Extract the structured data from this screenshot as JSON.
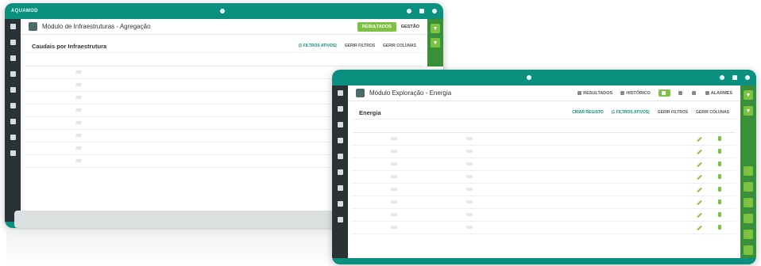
{
  "back_window": {
    "brand": "AQUAMOD",
    "page_title": "Módulo de Infraestruturas - Agregação",
    "actions": {
      "resultados": "RESULTADOS",
      "gestao": "GESTÃO"
    },
    "panel": {
      "title": "Caudais por Infraestrutura",
      "filter_label": "(1 FILTROS ATIVOS)",
      "gerir_filtros": "GERIR FILTROS",
      "gerir_colunas": "GERIR COLUNAS"
    },
    "columns": [
      "",
      "",
      "",
      "",
      "",
      "",
      "",
      ""
    ],
    "rows": [
      {
        "name": "",
        "type": "",
        "infra": "",
        "date": "",
        "value": "",
        "unit": "",
        "pct": "",
        "pct2": ""
      },
      {
        "name": "",
        "type": "",
        "infra": "",
        "date": "",
        "value": "",
        "unit": "",
        "pct": "",
        "pct2": ""
      },
      {
        "name": "",
        "type": "",
        "infra": "",
        "date": "",
        "value": "",
        "unit": "",
        "pct": "",
        "pct2": ""
      },
      {
        "name": "",
        "type": "",
        "infra": "",
        "date": "",
        "value": "",
        "unit": "",
        "pct": "",
        "pct2": ""
      },
      {
        "name": "",
        "type": "",
        "infra": "",
        "date": "",
        "value": "",
        "unit": "",
        "pct": "",
        "pct2": ""
      },
      {
        "name": "",
        "type": "",
        "infra": "",
        "date": "",
        "value": "",
        "unit": "",
        "pct": "",
        "pct2": ""
      },
      {
        "name": "",
        "type": "",
        "infra": "",
        "date": "",
        "value": "",
        "unit": "",
        "pct": "",
        "pct2": ""
      },
      {
        "name": "",
        "type": "",
        "infra": "",
        "date": "",
        "value": "",
        "unit": "",
        "pct": "",
        "pct2": ""
      }
    ]
  },
  "front_window": {
    "page_title": "Módulo Exploração - Energia",
    "tabs": [
      {
        "label": "RESULTADOS"
      },
      {
        "label": "HISTÓRICO"
      },
      {
        "label": "",
        "active": true
      },
      {
        "label": ""
      },
      {
        "label": ""
      },
      {
        "label": "ALARMES"
      }
    ],
    "panel": {
      "title": "Energia",
      "criar_registo": "CRIAR REGISTO",
      "filter_label": "(1 FILTROS ATIVOS)",
      "gerir_filtros": "GERIR FILTROS",
      "gerir_colunas": "GERIR COLUNAS"
    },
    "columns": [
      "",
      "",
      "",
      "",
      "",
      "",
      "",
      "",
      "",
      "",
      "",
      ""
    ],
    "rows": [
      {
        "name": "",
        "type": "",
        "year": "",
        "energy": "",
        "v1": "",
        "v2": "",
        "v3": "",
        "v4": "",
        "v5": "",
        "v6": ""
      },
      {
        "name": "",
        "type": "",
        "year": "",
        "energy": "",
        "v1": "",
        "v2": "",
        "v3": "",
        "v4": "",
        "v5": "",
        "v6": ""
      },
      {
        "name": "",
        "type": "",
        "year": "",
        "energy": "",
        "v1": "",
        "v2": "",
        "v3": "",
        "v4": "",
        "v5": "",
        "v6": ""
      },
      {
        "name": "",
        "type": "",
        "year": "",
        "energy": "",
        "v1": "",
        "v2": "",
        "v3": "",
        "v4": "",
        "v5": "",
        "v6": ""
      },
      {
        "name": "",
        "type": "",
        "year": "",
        "energy": "",
        "v1": "",
        "v2": "",
        "v3": "",
        "v4": "",
        "v5": "",
        "v6": ""
      },
      {
        "name": "",
        "type": "",
        "year": "",
        "energy": "",
        "v1": "",
        "v2": "",
        "v3": "",
        "v4": "",
        "v5": "",
        "v6": ""
      },
      {
        "name": "",
        "type": "",
        "year": "",
        "energy": "",
        "v1": "",
        "v2": "",
        "v3": "",
        "v4": "",
        "v5": "",
        "v6": ""
      },
      {
        "name": "",
        "type": "",
        "year": "",
        "energy": "",
        "v1": "",
        "v2": "",
        "v3": "",
        "v4": "",
        "v5": "",
        "v6": ""
      }
    ]
  },
  "colors": {
    "teal": "#0b8f7f",
    "green": "#7dc242",
    "dark_nav": "#2b3236"
  }
}
